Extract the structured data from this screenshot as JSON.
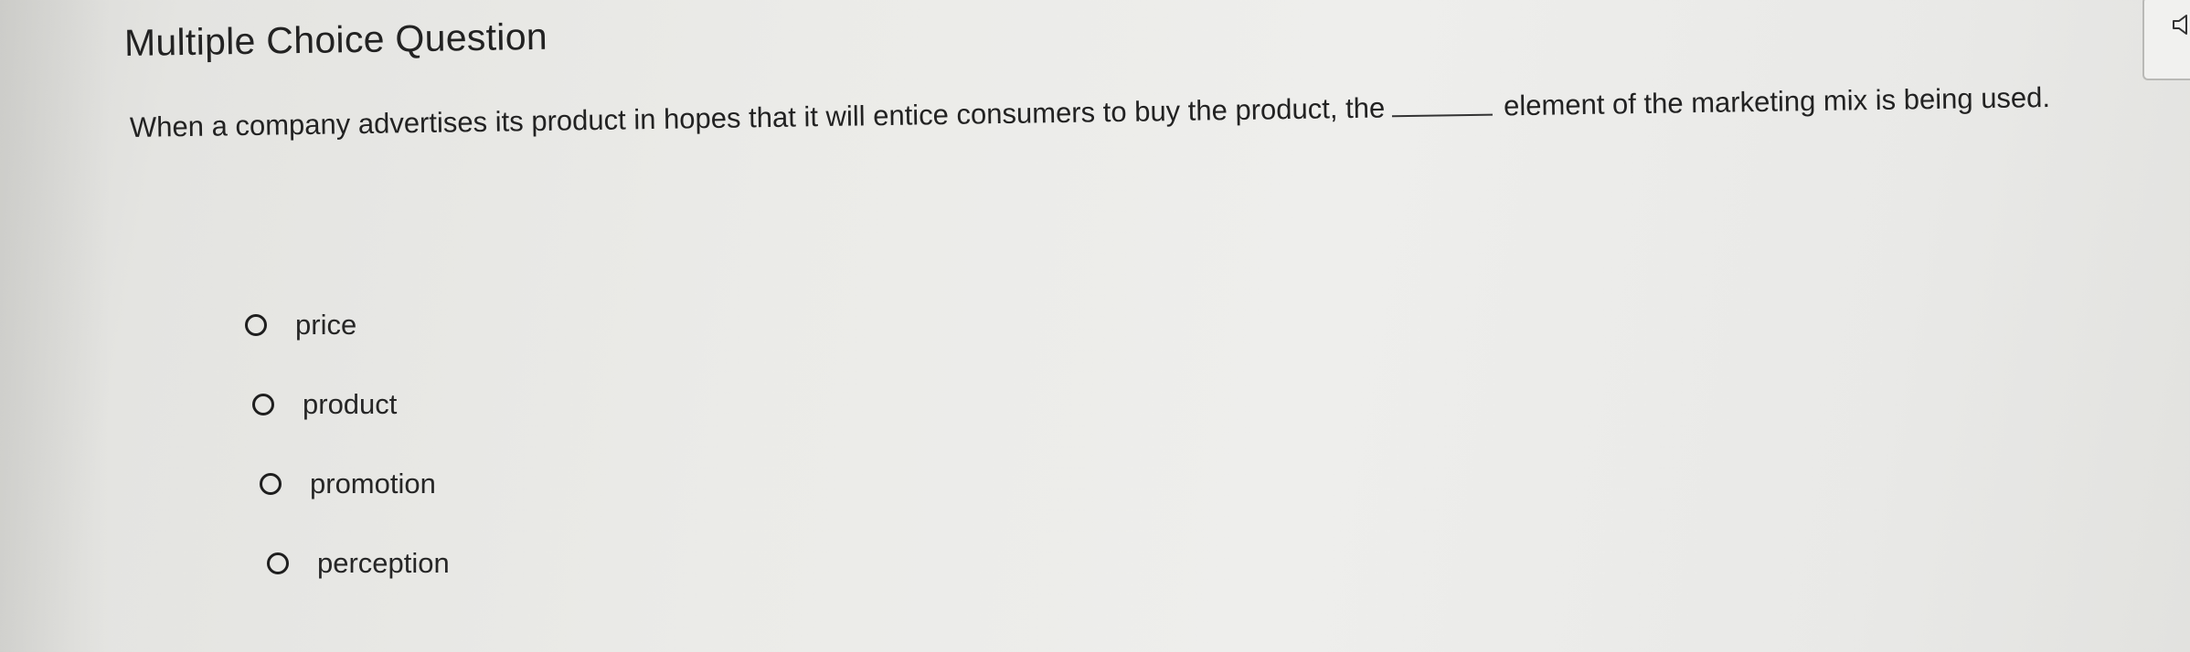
{
  "header": {
    "title": "Multiple Choice Question"
  },
  "question": {
    "text_before": "When a company advertises its product in hopes that it will entice consumers to buy the product, the",
    "text_after": "element of the marketing mix is being used."
  },
  "options": [
    {
      "label": "price",
      "selected": false
    },
    {
      "label": "product",
      "selected": false
    },
    {
      "label": "promotion",
      "selected": false
    },
    {
      "label": "perception",
      "selected": false
    }
  ],
  "audio": {
    "icon": "speaker-icon"
  }
}
